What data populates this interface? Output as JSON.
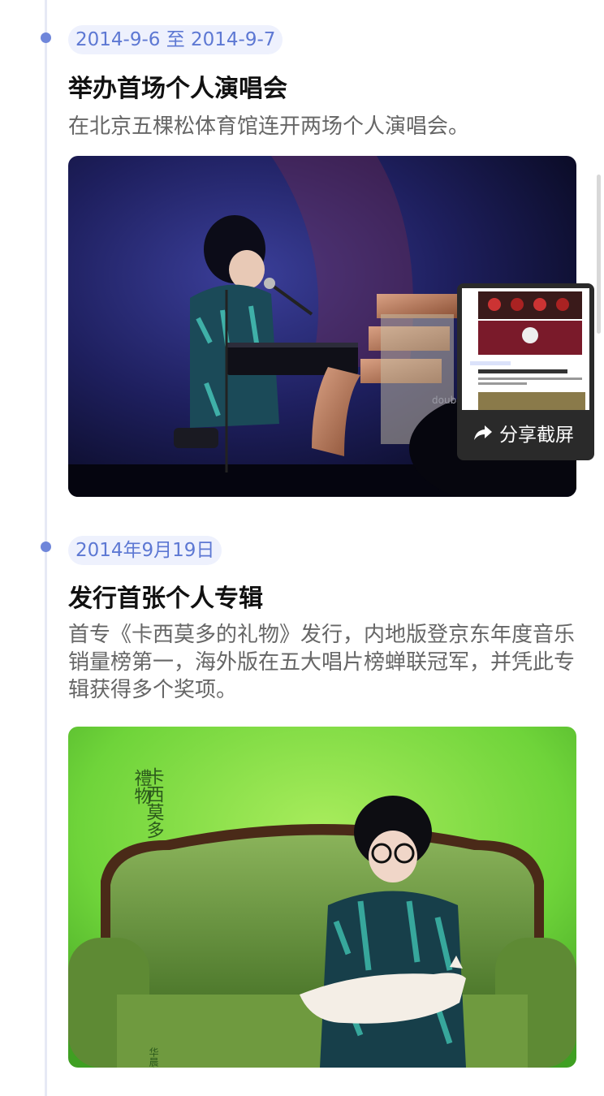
{
  "events": [
    {
      "date": "2014-9-6 至 2014-9-7",
      "title": "举办首场个人演唱会",
      "description": "在北京五棵松体育馆连开两场个人演唱会。"
    },
    {
      "date": "2014年9月19日",
      "title": "发行首张个人专辑",
      "description": "首专《卡西莫多的礼物》发行，内地版登京东年度音乐销量榜第一，海外版在五大唱片榜蝉联冠军，并凭此专辑获得多个奖项。"
    }
  ],
  "album_cover": {
    "title_main": "卡西莫多",
    "title_sub": "禮物",
    "artist": "华晨宇"
  },
  "share_popup": {
    "label": "分享截屏",
    "icon": "share-arrow-icon"
  },
  "colors": {
    "accent": "#6f86da",
    "date_text": "#5d78d3",
    "date_bg": "#eef1fd",
    "timeline": "#e6e9f5"
  }
}
